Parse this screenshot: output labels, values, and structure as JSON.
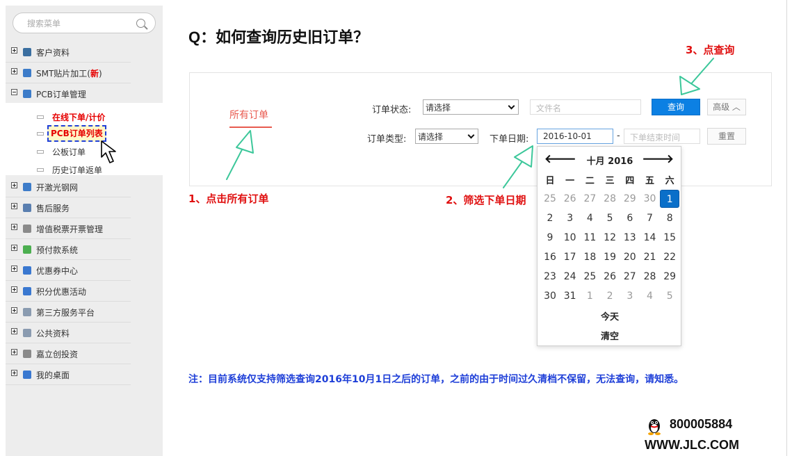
{
  "sidebar": {
    "search_placeholder": "搜索菜单",
    "items": [
      {
        "label": "客户资料",
        "expanded": false,
        "icon": "customer-icon",
        "color": "#3b6fa0"
      },
      {
        "label": "SMT贴片加工(",
        "badge": "新",
        "suffix": ")",
        "expanded": false,
        "icon": "chip-icon",
        "color": "#3d7cc9"
      },
      {
        "label": "PCB订单管理",
        "expanded": true,
        "icon": "pcb-icon",
        "color": "#3d7cc9"
      },
      {
        "label": "开激光钢网",
        "expanded": false,
        "icon": "stencil-icon",
        "color": "#3d7cc9"
      },
      {
        "label": "售后服务",
        "expanded": false,
        "icon": "service-icon",
        "color": "#5a7fb0"
      },
      {
        "label": "增值税票开票管理",
        "expanded": false,
        "icon": "invoice-icon",
        "color": "#8a8a8a"
      },
      {
        "label": "预付款系统",
        "expanded": false,
        "icon": "prepay-icon",
        "color": "#4caf50"
      },
      {
        "label": "优惠券中心",
        "expanded": false,
        "icon": "coupon-icon",
        "color": "#3a78d0"
      },
      {
        "label": "积分优惠活动",
        "expanded": false,
        "icon": "points-icon",
        "color": "#3a78d0"
      },
      {
        "label": "第三方服务平台",
        "expanded": false,
        "icon": "platform-icon",
        "color": "#8a9bb0"
      },
      {
        "label": "公共资料",
        "expanded": false,
        "icon": "public-docs-icon",
        "color": "#8a9bb0"
      },
      {
        "label": "嘉立创投资",
        "expanded": false,
        "icon": "investment-icon",
        "color": "#8a8a8a"
      },
      {
        "label": "我的桌面",
        "expanded": false,
        "icon": "desktop-icon",
        "color": "#3a78d0"
      }
    ],
    "pcb_subitems": [
      {
        "label": "在线下单/计价"
      },
      {
        "label": "PCB订单列表"
      },
      {
        "label": "公板订单"
      },
      {
        "label": "历史订单返单"
      }
    ]
  },
  "main": {
    "title": "Q：如何查询历史旧订单？",
    "tab_all": "所有订单",
    "order_status_label": "订单状态:",
    "order_status_value": "请选择",
    "filename_placeholder": "文件名",
    "query_button": "查询",
    "advanced_button": "高级 ︿",
    "order_type_label": "订单类型:",
    "order_type_value": "请选择",
    "order_date_label": "下单日期:",
    "date_start": "2016-10-01",
    "date_sep": "-",
    "date_end_placeholder": "下单结束时间",
    "reset_button": "重置"
  },
  "calendar": {
    "prev": "🡐",
    "next": "🡒",
    "title": "十月 2016",
    "weekdays": [
      "日",
      "一",
      "二",
      "三",
      "四",
      "五",
      "六"
    ],
    "weeks": [
      [
        [
          "25",
          1
        ],
        [
          "26",
          1
        ],
        [
          "27",
          1
        ],
        [
          "28",
          1
        ],
        [
          "29",
          1
        ],
        [
          "30",
          1
        ],
        [
          "1",
          2
        ]
      ],
      [
        [
          "2",
          0
        ],
        [
          "3",
          0
        ],
        [
          "4",
          0
        ],
        [
          "5",
          0
        ],
        [
          "6",
          0
        ],
        [
          "7",
          0
        ],
        [
          "8",
          0
        ]
      ],
      [
        [
          "9",
          0
        ],
        [
          "10",
          0
        ],
        [
          "11",
          0
        ],
        [
          "12",
          0
        ],
        [
          "13",
          0
        ],
        [
          "14",
          0
        ],
        [
          "15",
          0
        ]
      ],
      [
        [
          "16",
          0
        ],
        [
          "17",
          0
        ],
        [
          "18",
          0
        ],
        [
          "19",
          0
        ],
        [
          "20",
          0
        ],
        [
          "21",
          0
        ],
        [
          "22",
          0
        ]
      ],
      [
        [
          "23",
          0
        ],
        [
          "24",
          0
        ],
        [
          "25",
          0
        ],
        [
          "26",
          0
        ],
        [
          "27",
          0
        ],
        [
          "28",
          0
        ],
        [
          "29",
          0
        ]
      ],
      [
        [
          "30",
          0
        ],
        [
          "31",
          0
        ],
        [
          "1",
          1
        ],
        [
          "2",
          1
        ],
        [
          "3",
          1
        ],
        [
          "4",
          1
        ],
        [
          "5",
          1
        ]
      ]
    ],
    "today": "今天",
    "clear": "清空"
  },
  "annotations": {
    "step1": "1、点击所有订单",
    "step2": "2、筛选下单日期",
    "step3": "3、点查询",
    "note": "注：目前系统仅支持筛选查询2016年10月1日之后的订单，之前的由于时间过久清档不保留，无法查询，请知悉。",
    "color_red": "#e01010",
    "color_blue": "#1e3fd8",
    "arrow_color": "#3cc79a"
  },
  "contact": {
    "phone": "800005884",
    "website": "WWW.JLC.COM"
  }
}
